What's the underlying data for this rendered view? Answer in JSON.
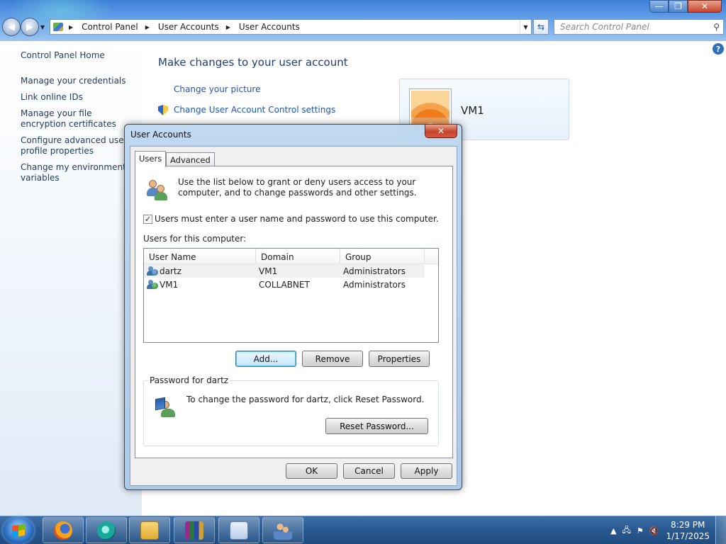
{
  "window": {
    "breadcrumb": [
      "Control Panel",
      "User Accounts",
      "User Accounts"
    ],
    "search_placeholder": "Search Control Panel",
    "controls": {
      "minimize": "—",
      "maximize": "❐",
      "close": "✕"
    }
  },
  "sidebar": {
    "items": [
      {
        "label": "Control Panel Home"
      },
      {
        "label": "Manage your credentials"
      },
      {
        "label": "Link online IDs"
      },
      {
        "label": "Manage your file encryption certificates"
      },
      {
        "label": "Configure advanced user profile properties"
      },
      {
        "label": "Change my environment variables"
      }
    ]
  },
  "main": {
    "heading": "Make changes to your user account",
    "links": [
      {
        "label": "Change your picture"
      },
      {
        "label": "Change User Account Control settings"
      }
    ],
    "account_card": {
      "name": "VM1"
    },
    "help": "?"
  },
  "dialog": {
    "title": "User Accounts",
    "close": "✕",
    "tabs": [
      {
        "label": "Users"
      },
      {
        "label": "Advanced"
      }
    ],
    "intro": "Use the list below to grant or deny users access to your computer, and to change passwords and other settings.",
    "require_password": {
      "label": "Users must enter a user name and password to use this computer.",
      "checked": true
    },
    "list_label": "Users for this computer:",
    "columns": [
      "User Name",
      "Domain",
      "Group"
    ],
    "rows": [
      {
        "name": "dartz",
        "domain": "VM1",
        "group": "Administrators"
      },
      {
        "name": "VM1",
        "domain": "COLLABNET",
        "group": "Administrators"
      }
    ],
    "buttons": {
      "add": "Add...",
      "remove": "Remove",
      "properties": "Properties"
    },
    "password_group": {
      "title": "Password for dartz",
      "text": "To change the password for dartz, click Reset Password.",
      "reset": "Reset Password..."
    },
    "footer": {
      "ok": "OK",
      "cancel": "Cancel",
      "apply": "Apply"
    }
  },
  "taskbar": {
    "clock_time": "8:29 PM",
    "clock_date": "1/17/2025",
    "tray_chevron": "▲"
  }
}
